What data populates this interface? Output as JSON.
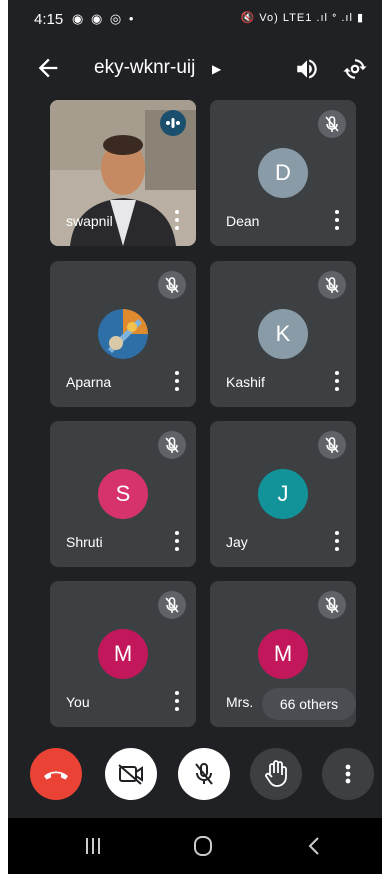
{
  "status_bar": {
    "time": "4:15",
    "left_icons": "◉ ◉ ◎ •",
    "right_icons": "🔇 Vo) LTE1 .ıl ᐤ .ıl ▮"
  },
  "header": {
    "meeting_code": "eky-wknr-uij"
  },
  "participants": [
    {
      "name": "swapnil",
      "initial": "",
      "color": "",
      "speaking": true,
      "muted": false
    },
    {
      "name": "Dean",
      "initial": "D",
      "color": "#8a9ba8",
      "muted": true
    },
    {
      "name": "Aparna",
      "initial": "",
      "color": "",
      "muted": true
    },
    {
      "name": "Kashif",
      "initial": "K",
      "color": "#8a9ba8",
      "muted": true
    },
    {
      "name": "Shruti",
      "initial": "S",
      "color": "#d6336c",
      "muted": true
    },
    {
      "name": "Jay",
      "initial": "J",
      "color": "#12939a",
      "muted": true
    },
    {
      "name": "You",
      "initial": "M",
      "color": "#c2185b",
      "muted": true
    },
    {
      "name": "Mrs. ",
      "initial": "M",
      "color": "#c2185b",
      "muted": true
    }
  ],
  "others_label": "66 others",
  "controls": {
    "end_call_color": "#ea4335",
    "camera_bg": "#ffffff",
    "mic_bg": "#ffffff",
    "hand_bg": "#3c4043",
    "more_bg": "#3c4043"
  }
}
